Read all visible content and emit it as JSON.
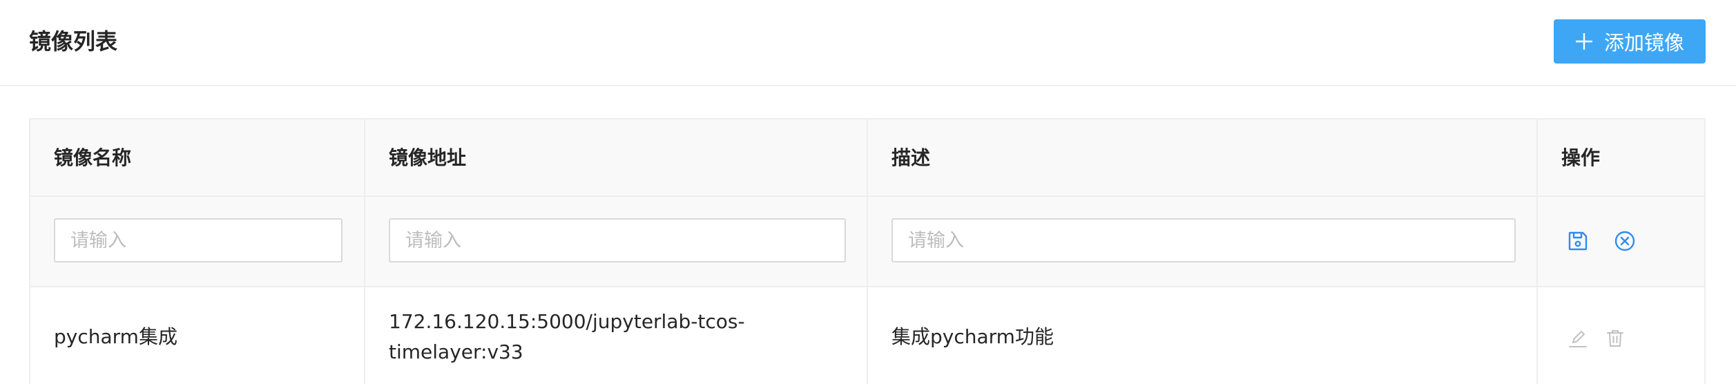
{
  "header": {
    "title": "镜像列表",
    "add_button_label": "添加镜像"
  },
  "table": {
    "columns": [
      "镜像名称",
      "镜像地址",
      "描述",
      "操作"
    ],
    "edit_row": {
      "name_placeholder": "请输入",
      "address_placeholder": "请输入",
      "description_placeholder": "请输入",
      "actions": [
        "save-icon",
        "cancel-icon"
      ]
    },
    "rows": [
      {
        "name": "pycharm集成",
        "address": "172.16.120.15:5000/jupyterlab-tcos-timelayer:v33",
        "description": "集成pycharm功能",
        "actions": [
          "edit-icon",
          "delete-icon"
        ]
      }
    ]
  },
  "colors": {
    "accent": "#3ea7f5",
    "action_blue": "#2d8cf0",
    "disabled_icon": "#c0c0c0",
    "header_bg": "#f9f9f9",
    "border": "#eeeeee"
  }
}
